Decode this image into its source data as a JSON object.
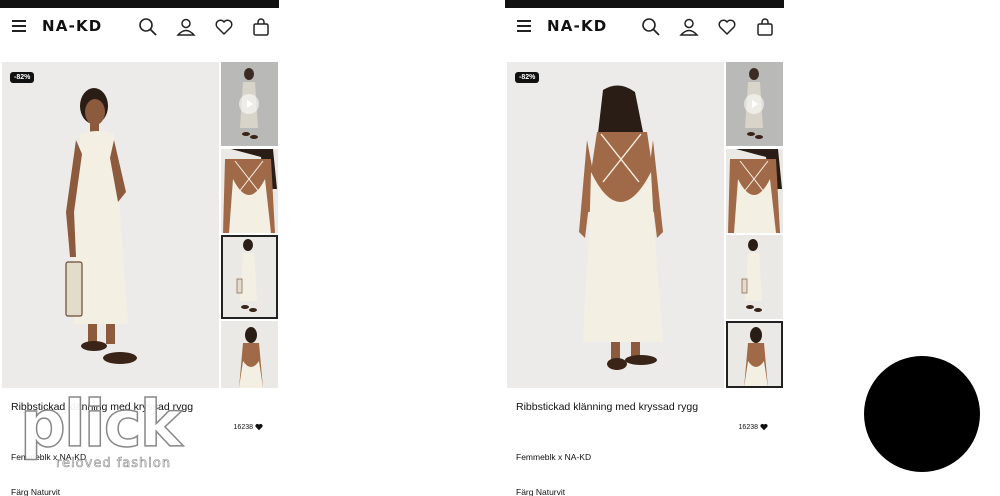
{
  "header": {
    "logo": "NA-KD",
    "icons": [
      "menu-icon",
      "search-icon",
      "account-icon",
      "heart-icon",
      "bag-icon"
    ]
  },
  "left": {
    "badge": "-82%",
    "title": "Ribbstickad klänning med kryssad rygg",
    "likes": "16238",
    "brand": "Femmeblk x NA-KD",
    "color": "Färg Naturvit"
  },
  "right": {
    "badge": "-82%",
    "title": "Ribbstickad klänning med kryssad rygg",
    "likes": "16238",
    "brand": "Femmeblk x NA-KD",
    "color": "Färg Naturvit"
  },
  "watermark": {
    "main": "plick",
    "sub": "reloved fashion"
  },
  "colors": {
    "accent": "#111111",
    "background": "#ffffff",
    "image_bg": "#ecebe9"
  }
}
